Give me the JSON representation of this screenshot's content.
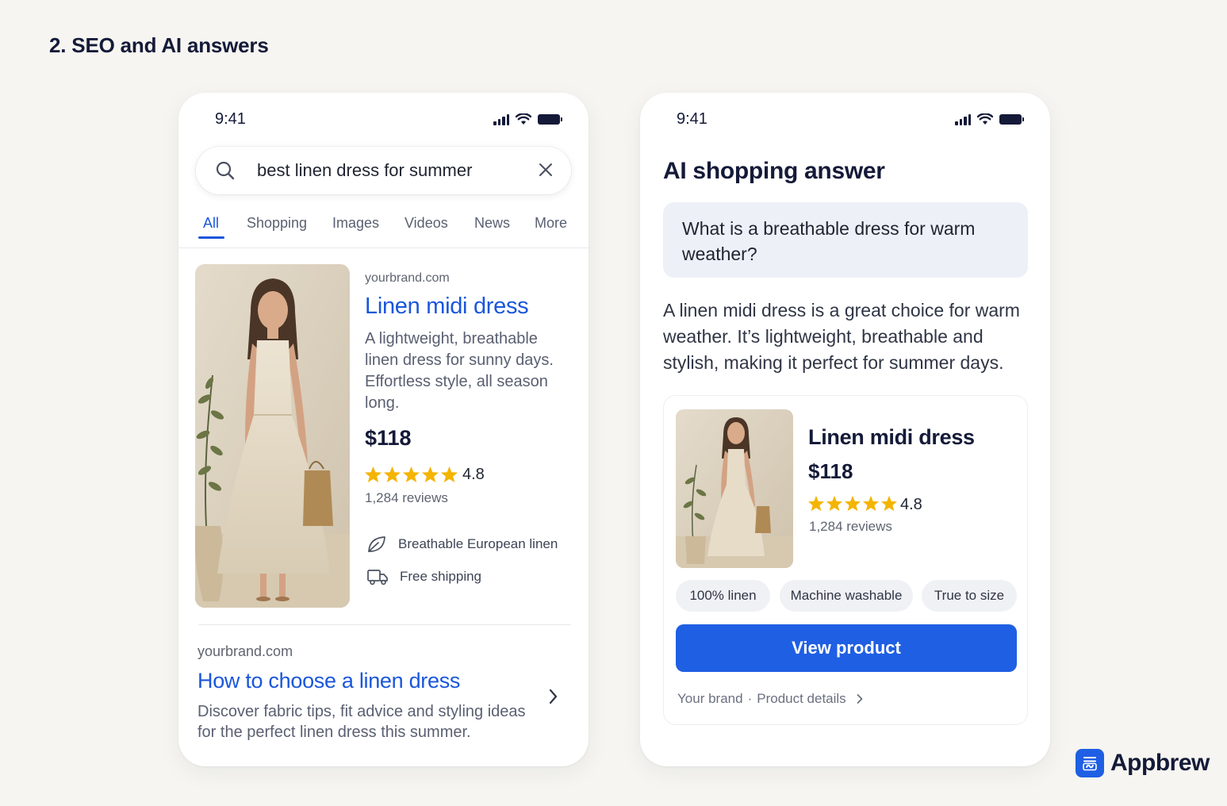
{
  "page": {
    "section_title": "2. SEO and AI answers"
  },
  "left_phone": {
    "status_time": "9:41",
    "search": {
      "query": "best linen dress for summer"
    },
    "tabs": [
      {
        "label": "All",
        "active": true
      },
      {
        "label": "Shopping"
      },
      {
        "label": "Images"
      },
      {
        "label": "Videos"
      },
      {
        "label": "News"
      },
      {
        "label": "More"
      }
    ],
    "result1": {
      "domain": "yourbrand.com",
      "title": "Linen midi dress",
      "description": "A lightweight, breathable linen dress for sunny days. Effortless style, all season long.",
      "price": "$118",
      "rating": "4.8",
      "stars": 5,
      "reviews": "1,284 reviews",
      "features": [
        {
          "icon": "leaf-icon",
          "label": "Breathable European linen"
        },
        {
          "icon": "truck-icon",
          "label": "Free shipping"
        }
      ]
    },
    "result2": {
      "domain": "yourbrand.com",
      "title": "How to choose a linen dress",
      "description": "Discover fabric tips, fit advice and styling ideas for the perfect linen dress this summer."
    }
  },
  "right_phone": {
    "status_time": "9:41",
    "title": "AI shopping answer",
    "question": "What is a breathable dress for warm weather?",
    "answer": "A linen midi dress is a great choice for warm weather. It’s lightweight, breathable and stylish, making it perfect for summer days.",
    "product": {
      "title": "Linen midi dress",
      "price": "$118",
      "rating": "4.8",
      "stars": 5,
      "reviews": "1,284 reviews",
      "chips": [
        "100% linen",
        "Machine washable",
        "True to size"
      ],
      "cta": "View product",
      "footer_brand": "Your brand",
      "footer_sep": "·",
      "footer_link": "Product details"
    }
  },
  "brand": {
    "name": "Appbrew"
  },
  "colors": {
    "accent": "#1a56db",
    "cta": "#1f5fe3",
    "star": "#f4b400",
    "heading": "#141a38"
  }
}
